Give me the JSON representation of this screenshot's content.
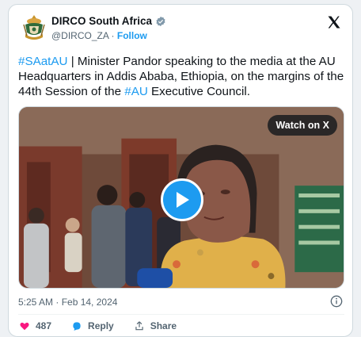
{
  "account": {
    "name": "DIRCO South Africa",
    "handle": "@DIRCO_ZA",
    "separator": "·",
    "follow_label": "Follow"
  },
  "tweet": {
    "hashtag1": "#SAatAU",
    "text1": " | Minister Pandor speaking to the media at the AU Headquarters in Addis Ababa, Ethiopia, on the margins of the 44th Session of the ",
    "hashtag2": "#AU",
    "text2": " Executive Council."
  },
  "media": {
    "watch_label": "Watch on X"
  },
  "meta": {
    "timestamp": "5:25 AM · Feb 14, 2024"
  },
  "actions": {
    "like_count": "487",
    "reply_label": "Reply",
    "share_label": "Share"
  },
  "colors": {
    "accent": "#1d9bf0",
    "text": "#0f1419",
    "muted": "#536471",
    "like": "#f91880"
  },
  "icons": [
    "coat-of-arms-icon",
    "verified-badge-icon",
    "x-logo-icon",
    "play-icon",
    "info-icon",
    "heart-icon",
    "reply-icon",
    "share-icon"
  ]
}
